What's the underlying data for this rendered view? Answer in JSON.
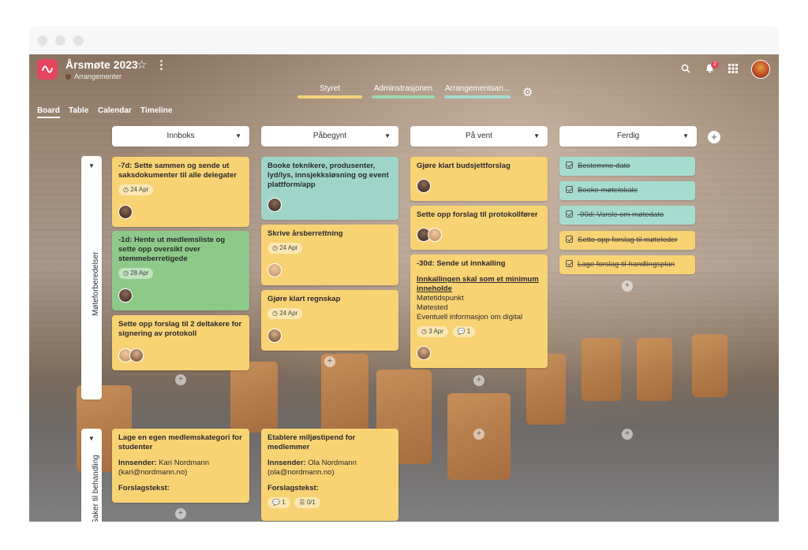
{
  "app": {
    "title": "Årsmøte 2023",
    "subtitle": "Arrangementer",
    "notifications_count": "2"
  },
  "groups": [
    {
      "label": "Styret",
      "color": "#f4d27a"
    },
    {
      "label": "Adminstrasjonen",
      "color": "#9ed8b0"
    },
    {
      "label": "Arrangementsan...",
      "color": "#a6dcd0"
    }
  ],
  "views": [
    "Board",
    "Table",
    "Calendar",
    "Timeline"
  ],
  "columns": [
    "Innboks",
    "Påbegynt",
    "På vent",
    "Ferdig"
  ],
  "lanes": [
    "Møteforberedelser",
    "Saker til behandling"
  ],
  "cards": {
    "innboks": [
      {
        "title": "-7d: Sette sammen og sende ut saksdokumenter til alle delegater",
        "date": "24 Apr"
      },
      {
        "title": "-1d: Hente ut medlemsliste og sette opp oversikt over stemmeberretigede",
        "date": "28 Apr"
      },
      {
        "title": "Sette opp forslag til 2 deltakere for signering av protokoll"
      }
    ],
    "pabegynt": [
      {
        "title": "Booke teknikere, produsenter, lyd/lys, innsjekksløsning og event plattform/app"
      },
      {
        "title": "Skrive årsberrettning",
        "date": "24 Apr"
      },
      {
        "title": "Gjøre klart regnskap",
        "date": "24 Apr"
      }
    ],
    "pavent": [
      {
        "title": "Gjøre klart budsjettforslag"
      },
      {
        "title": "Sette opp forslag til protokollfører"
      },
      {
        "title": "-30d: Sende ut innkalling",
        "subhead": "Innkallingen skal som et minimum inneholde",
        "lines": [
          "Møtetidspunkt",
          "Møtested",
          "Eventuell informasjon om digital"
        ],
        "date": "3 Apr",
        "comments": "1"
      }
    ],
    "ferdig": [
      {
        "title": "Bestemme dato",
        "color": "#a6dcd0"
      },
      {
        "title": "Booke møtelokale",
        "color": "#a6dcd0"
      },
      {
        "title": "-90d: Varsle om møtedato",
        "color": "#a6dcd0"
      },
      {
        "title": "Sette opp forslag til møteleder",
        "color": "#f8d374"
      },
      {
        "title": "Lage forslag til handlingsplan",
        "color": "#f8d374"
      }
    ]
  },
  "lane2_cards": [
    {
      "title": "Lage en egen medlemskategori for studenter",
      "sender_label": "Innsender:",
      "sender_name": "Kari Nordmann",
      "sender_email": "(kari@nordmann.no)",
      "text_label": "Forslagstekst:"
    },
    {
      "title": "Etablere miljøstipend for medlemmer",
      "sender_label": "Innsender:",
      "sender_name": "Ola Nordmann",
      "sender_email": "(ola@nordmann.no)",
      "text_label": "Forslagstekst:",
      "comments": "1",
      "checklist": "0/1"
    }
  ],
  "icons": [
    "search-icon",
    "bell-icon",
    "apps-grid-icon",
    "gear-icon",
    "star-icon",
    "kebab-icon",
    "clock-icon",
    "comment-icon",
    "checklist-icon",
    "plus-icon"
  ]
}
